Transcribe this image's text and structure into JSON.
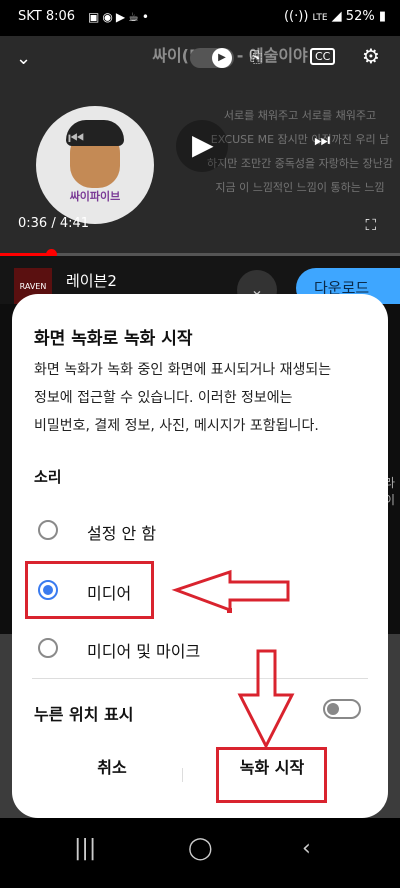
{
  "status_bar": {
    "carrier_time": "SKT 8:06",
    "left_icons": [
      "image-icon",
      "chat-icon",
      "play-store-icon",
      "cafe-icon",
      "dot-icon"
    ],
    "right_icons": [
      "hotspot-icon",
      "lte-icon",
      "signal-icon"
    ],
    "network": "LTE",
    "battery": "52%"
  },
  "video": {
    "title": "싸이(PSY) - 예술이야",
    "lyrics": [
      "서로를 채워주고 서로를 채워주고",
      "EXCUSE ME 잠시만 아직까진 우리 남",
      "하지만 조만간 중독성을 자랑하는 장난감",
      "지금 이 느낌적인 느낌이 통하는 느낌"
    ],
    "avatar_caption": "싸이파이브",
    "elapsed": "0:36",
    "separator": "/",
    "duration": "4:41",
    "progress_fraction": 0.128
  },
  "ad": {
    "icon_text": "RAVEN",
    "name": "레이븐2",
    "download": "다운로드"
  },
  "background": {
    "side_text": "라이"
  },
  "dialog": {
    "title": "화면 녹화로 녹화 시작",
    "description": "화면 녹화가 녹화 중인 화면에 표시되거나 재생되는\n정보에 접근할 수 있습니다. 이러한 정보에는\n비밀번호, 결제 정보, 사진, 메시지가 포함됩니다.",
    "sound_heading": "소리",
    "options": [
      {
        "label": "설정 안 함",
        "selected": false
      },
      {
        "label": "미디어",
        "selected": true
      },
      {
        "label": "미디어 및 마이크",
        "selected": false
      }
    ],
    "touch_label": "누른 위치 표시",
    "touch_enabled": false,
    "cancel": "취소",
    "start": "녹화 시작"
  },
  "annotation_color": "#d9232e",
  "accent": "#3a7bef"
}
